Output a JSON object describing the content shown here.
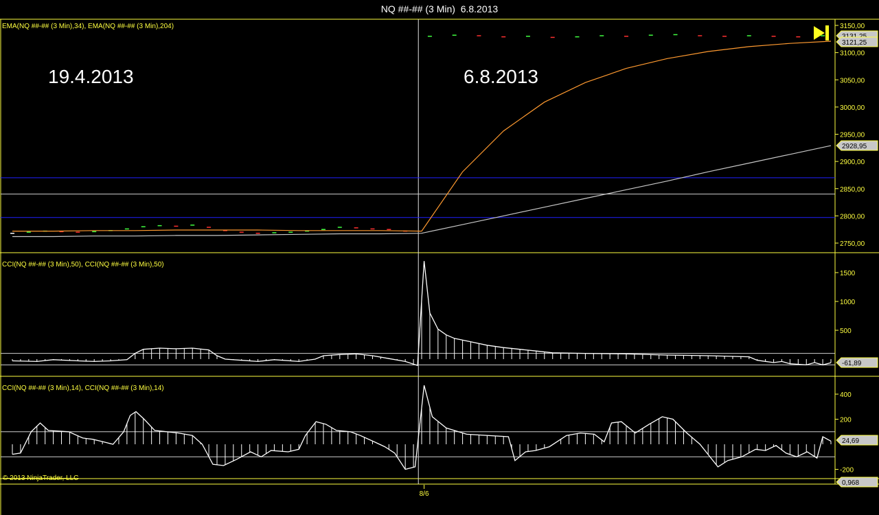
{
  "title": "NQ ##-## (3 Min)  6.8.2013",
  "copyright": "© 2013 NinjaTrader, LLC",
  "annotations": {
    "left_date": "19.4.2013",
    "right_date": "6.8.2013"
  },
  "colors": {
    "axis": "#ffff40",
    "ema34": "#ff9a30",
    "ema204": "#c8c8c8",
    "cci": "#ffffff",
    "blue_line": "#2020ff",
    "up": "#40ff40",
    "down": "#ff3030"
  },
  "chart_data": [
    {
      "type": "line",
      "panel": "price",
      "legend": "EMA(NQ ##-## (3 Min),34), EMA(NQ ##-## (3 Min),204)",
      "ylim": [
        2730,
        3160
      ],
      "yticks": [
        2750,
        2800,
        2850,
        2900,
        2950,
        3000,
        3050,
        3100,
        3150
      ],
      "ytick_labels": [
        "2750,00",
        "2800,00",
        "2850,00",
        "2900,00",
        "2950,00",
        "3000,00",
        "3050,00",
        "3100,00",
        "3150,00"
      ],
      "xlabel_ticks": [
        {
          "bar": 50,
          "label": "8/6"
        }
      ],
      "hlines": [
        {
          "value": 2870,
          "color": "blue"
        },
        {
          "value": 2840,
          "color": "white"
        },
        {
          "value": 2797,
          "color": "blue"
        }
      ],
      "series": [
        {
          "name": "EMA34",
          "points": [
            [
              0,
              2772
            ],
            [
              5,
              2772
            ],
            [
              10,
              2773
            ],
            [
              15,
              2773
            ],
            [
              20,
              2774
            ],
            [
              25,
              2774
            ],
            [
              30,
              2774
            ],
            [
              35,
              2773
            ],
            [
              40,
              2773
            ],
            [
              45,
              2773
            ],
            [
              50,
              2772
            ],
            [
              55,
              2881
            ],
            [
              60,
              2956
            ],
            [
              65,
              3009
            ],
            [
              70,
              3045
            ],
            [
              75,
              3071
            ],
            [
              80,
              3089
            ],
            [
              85,
              3102
            ],
            [
              90,
              3111
            ],
            [
              95,
              3117
            ],
            [
              100,
              3121
            ]
          ]
        },
        {
          "name": "EMA204",
          "points": [
            [
              0,
              2762
            ],
            [
              5,
              2762
            ],
            [
              10,
              2763
            ],
            [
              15,
              2763
            ],
            [
              20,
              2764
            ],
            [
              25,
              2764
            ],
            [
              30,
              2765
            ],
            [
              35,
              2766
            ],
            [
              40,
              2767
            ],
            [
              45,
              2767
            ],
            [
              50,
              2768
            ],
            [
              55,
              2784
            ],
            [
              60,
              2800
            ],
            [
              65,
              2816
            ],
            [
              70,
              2832
            ],
            [
              75,
              2848
            ],
            [
              80,
              2864
            ],
            [
              85,
              2881
            ],
            [
              90,
              2897
            ],
            [
              95,
              2913
            ],
            [
              100,
              2929
            ]
          ]
        },
        {
          "name": "Close",
          "points": [
            [
              0,
              2768
            ],
            [
              2,
              2770
            ],
            [
              4,
              2772
            ],
            [
              6,
              2771
            ],
            [
              8,
              2770
            ],
            [
              10,
              2771
            ],
            [
              12,
              2773
            ],
            [
              14,
              2776
            ],
            [
              16,
              2780
            ],
            [
              18,
              2782
            ],
            [
              20,
              2781
            ],
            [
              22,
              2783
            ],
            [
              24,
              2779
            ],
            [
              26,
              2773
            ],
            [
              28,
              2770
            ],
            [
              30,
              2768
            ],
            [
              32,
              2769
            ],
            [
              34,
              2770
            ],
            [
              36,
              2772
            ],
            [
              38,
              2775
            ],
            [
              40,
              2779
            ],
            [
              42,
              2778
            ],
            [
              44,
              2776
            ],
            [
              46,
              2775
            ],
            [
              48,
              2772
            ],
            [
              51,
              3130
            ],
            [
              54,
              3132
            ],
            [
              57,
              3131
            ],
            [
              60,
              3129
            ],
            [
              63,
              3130
            ],
            [
              66,
              3128
            ],
            [
              69,
              3129
            ],
            [
              72,
              3131
            ],
            [
              75,
              3130
            ],
            [
              78,
              3132
            ],
            [
              81,
              3133
            ],
            [
              84,
              3131
            ],
            [
              87,
              3130
            ],
            [
              90,
              3131
            ],
            [
              93,
              3130
            ],
            [
              96,
              3129
            ],
            [
              99,
              3131
            ]
          ]
        }
      ],
      "value_labels": [
        "3131,25",
        "3121,25",
        "2928,95"
      ]
    },
    {
      "type": "line",
      "panel": "cci50",
      "legend": "CCI(NQ ##-## (3 Min),50), CCI(NQ ##-## (3 Min),50)",
      "ylim": [
        -200,
        1900
      ],
      "yticks": [
        500,
        1000,
        1500
      ],
      "ytick_labels": [
        "500",
        "1000",
        "1500"
      ],
      "hlines": [
        {
          "value": 100
        },
        {
          "value": -100
        }
      ],
      "series": [
        {
          "name": "CCI50",
          "points": [
            [
              0,
              -30
            ],
            [
              3,
              -40
            ],
            [
              5,
              -10
            ],
            [
              8,
              -30
            ],
            [
              10,
              -40
            ],
            [
              12,
              -30
            ],
            [
              14,
              -10
            ],
            [
              15,
              100
            ],
            [
              16,
              170
            ],
            [
              18,
              190
            ],
            [
              20,
              180
            ],
            [
              22,
              190
            ],
            [
              24,
              160
            ],
            [
              25,
              60
            ],
            [
              26,
              0
            ],
            [
              28,
              -20
            ],
            [
              30,
              -40
            ],
            [
              32,
              -10
            ],
            [
              35,
              -40
            ],
            [
              37,
              0
            ],
            [
              38,
              60
            ],
            [
              40,
              80
            ],
            [
              42,
              90
            ],
            [
              44,
              60
            ],
            [
              46,
              10
            ],
            [
              48,
              -40
            ],
            [
              49.5,
              -110
            ],
            [
              50.3,
              1700
            ],
            [
              51,
              800
            ],
            [
              52,
              520
            ],
            [
              53,
              420
            ],
            [
              54,
              360
            ],
            [
              56,
              300
            ],
            [
              58,
              240
            ],
            [
              60,
              200
            ],
            [
              62,
              170
            ],
            [
              64,
              140
            ],
            [
              66,
              110
            ],
            [
              70,
              100
            ],
            [
              75,
              90
            ],
            [
              80,
              70
            ],
            [
              85,
              60
            ],
            [
              90,
              40
            ],
            [
              91,
              -20
            ],
            [
              93,
              -60
            ],
            [
              94,
              -40
            ],
            [
              95,
              -80
            ],
            [
              97,
              -100
            ],
            [
              98,
              -60
            ],
            [
              99,
              -100
            ],
            [
              100,
              -62
            ]
          ]
        }
      ],
      "value_labels": [
        "-61,89"
      ]
    },
    {
      "type": "line",
      "panel": "cci14",
      "legend": "CCI(NQ ##-## (3 Min),14), CCI(NQ ##-## (3 Min),14)",
      "ylim": [
        -230,
        500
      ],
      "yticks": [
        -200,
        200,
        400
      ],
      "ytick_labels": [
        "-200",
        "200",
        "400"
      ],
      "hlines": [
        {
          "value": 100
        },
        {
          "value": -100
        }
      ],
      "series": [
        {
          "name": "CCI14",
          "points": [
            [
              0,
              -80
            ],
            [
              1,
              -70
            ],
            [
              2.3,
              100
            ],
            [
              3.4,
              170
            ],
            [
              4.4,
              110
            ],
            [
              6.9,
              100
            ],
            [
              8.6,
              50
            ],
            [
              9.8,
              40
            ],
            [
              11.1,
              20
            ],
            [
              12.3,
              0
            ],
            [
              13.6,
              100
            ],
            [
              14.4,
              230
            ],
            [
              15.1,
              260
            ],
            [
              16.1,
              200
            ],
            [
              17.4,
              110
            ],
            [
              20.3,
              90
            ],
            [
              22,
              70
            ],
            [
              23.2,
              0
            ],
            [
              24.5,
              -160
            ],
            [
              25.8,
              -170
            ],
            [
              27.4,
              -120
            ],
            [
              29.1,
              -60
            ],
            [
              30.4,
              -100
            ],
            [
              31.6,
              -50
            ],
            [
              33.7,
              -60
            ],
            [
              35,
              -40
            ],
            [
              35.8,
              70
            ],
            [
              37.1,
              180
            ],
            [
              38.3,
              160
            ],
            [
              39.6,
              110
            ],
            [
              41.3,
              100
            ],
            [
              42.5,
              70
            ],
            [
              44.2,
              20
            ],
            [
              45.5,
              -20
            ],
            [
              46.7,
              -70
            ],
            [
              48,
              -200
            ],
            [
              49.2,
              -180
            ],
            [
              50.3,
              470
            ],
            [
              51.3,
              220
            ],
            [
              53,
              130
            ],
            [
              55.5,
              80
            ],
            [
              60.6,
              60
            ],
            [
              61.4,
              -130
            ],
            [
              62.7,
              -60
            ],
            [
              63.9,
              -50
            ],
            [
              65.6,
              -20
            ],
            [
              67.7,
              70
            ],
            [
              69.4,
              90
            ],
            [
              71.1,
              80
            ],
            [
              72.3,
              20
            ],
            [
              73.2,
              170
            ],
            [
              74.4,
              180
            ],
            [
              76.1,
              90
            ],
            [
              77.8,
              160
            ],
            [
              79.4,
              220
            ],
            [
              80.7,
              200
            ],
            [
              82.4,
              90
            ],
            [
              84,
              0
            ],
            [
              86.2,
              -180
            ],
            [
              87.4,
              -130
            ],
            [
              89.1,
              -100
            ],
            [
              90.8,
              -40
            ],
            [
              92,
              -50
            ],
            [
              93.3,
              -10
            ],
            [
              94.5,
              -70
            ],
            [
              95.8,
              -100
            ],
            [
              97.1,
              -60
            ],
            [
              98.3,
              -110
            ],
            [
              99,
              60
            ],
            [
              100,
              25
            ]
          ]
        }
      ],
      "value_labels": [
        "24,69"
      ]
    },
    {
      "type": "line",
      "panel": "small",
      "value_labels": [
        "0,968"
      ]
    }
  ]
}
